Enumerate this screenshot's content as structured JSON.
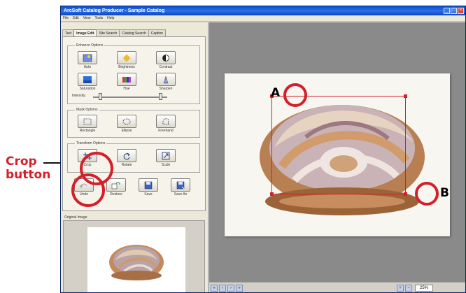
{
  "annotations": {
    "crop_label_line1": "Crop",
    "crop_label_line2": "button",
    "marker_a": "A",
    "marker_b": "B"
  },
  "window": {
    "title": "ArcSoft Catalog Producer - Sample Catalog",
    "controls": [
      "_",
      "□",
      "×"
    ]
  },
  "menu": [
    "File",
    "Edit",
    "View",
    "Tools",
    "Help"
  ],
  "tabs": [
    "Text",
    "Image Edit",
    "Site Search",
    "Catalog Search",
    "Caption"
  ],
  "active_tab": "Image Edit",
  "enhance": {
    "title": "Enhance Options",
    "tools": [
      "Auto",
      "Brightness",
      "Contrast",
      "Saturation",
      "Hue",
      "Sharpen"
    ],
    "intensity_label": "Intensity:"
  },
  "mask": {
    "title": "Mask Options",
    "tools": [
      "Rectangle",
      "Ellipse",
      "Freehand"
    ]
  },
  "transform": {
    "title": "Transform Options",
    "tools": [
      "Crop",
      "Rotate",
      "Scale"
    ]
  },
  "actions": [
    "Undo",
    "Restore",
    "Save",
    "Save As"
  ],
  "original_image_label": "Original Image",
  "status": {
    "zoom": "25%"
  },
  "colors": {
    "annotation_red": "#d3202a",
    "title_blue": "#0a4fd4",
    "panel_bg": "#ece9d8",
    "workspace_gray": "#8a8a8a"
  }
}
